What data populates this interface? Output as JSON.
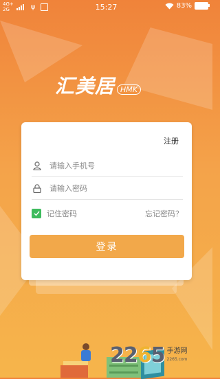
{
  "status_bar": {
    "network_top": "4G+",
    "network_bottom": "2G",
    "usb_label": "ψ",
    "time": "15:27",
    "battery_percent": "83%"
  },
  "logo": {
    "main": "汇美居",
    "sub": "HMK"
  },
  "login_card": {
    "register_label": "注册",
    "phone_placeholder": "请输入手机号",
    "password_placeholder": "请输入密码",
    "remember_label": "记住密码",
    "remember_checked": true,
    "forgot_label": "忘记密码？",
    "login_label": "登录"
  },
  "watermark": {
    "number_part1": "22",
    "number_part2": "6",
    "number_part3": "5",
    "text": "手游网",
    "sub_text": "2265.com"
  },
  "colors": {
    "bg_top": "#f0833a",
    "bg_bottom": "#f6b54b",
    "button": "#f2a84a",
    "checkbox": "#3dbb5d"
  },
  "icons": {
    "user": "user-icon",
    "lock": "lock-icon",
    "check": "check-icon",
    "wifi": "wifi-icon",
    "battery": "battery-icon"
  }
}
